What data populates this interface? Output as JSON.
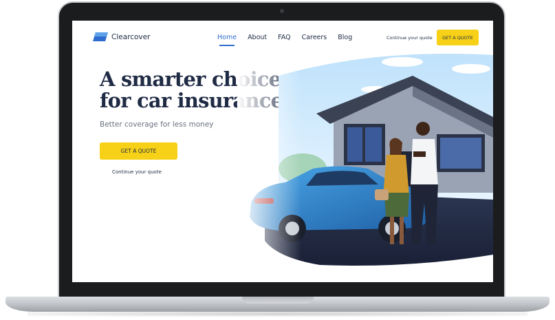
{
  "brand": {
    "name": "Clearcover",
    "logo_icon": "clearcover-logo-icon",
    "accent": "#2f6ccd",
    "cta_color": "#f7d117",
    "text_color": "#1f2a44"
  },
  "nav": {
    "links": [
      "Home",
      "About",
      "FAQ",
      "Careers",
      "Blog"
    ],
    "active": "Home",
    "continue_label": "Continue your quote",
    "quote_button": "GET A QUOTE"
  },
  "hero": {
    "title_line1": "A smarter choice",
    "title_line2": "for car insurance",
    "subtitle": "Better coverage for less money",
    "quote_button": "GET A QUOTE",
    "continue_label": "Continue your quote"
  }
}
